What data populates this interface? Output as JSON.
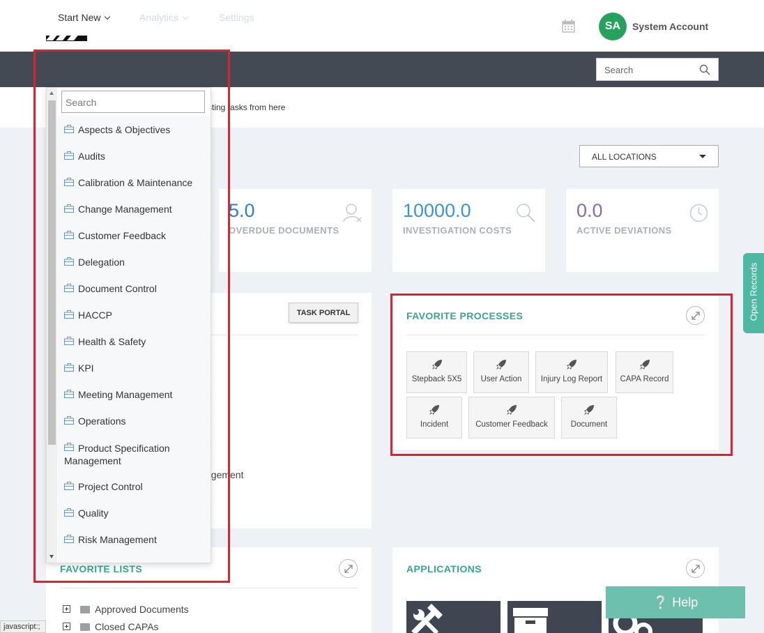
{
  "header": {
    "account_initials": "SA",
    "account_name": "System Account"
  },
  "nav": {
    "start_new": "Start New",
    "analytics": "Analytics",
    "settings": "Settings",
    "search_placeholder": "Search"
  },
  "subbar": {
    "text": "sting tasks from here"
  },
  "location_select": {
    "value": "ALL LOCATIONS"
  },
  "stats": [
    {
      "value": "5.0",
      "label": "OVERDUE DOCUMENTS",
      "icon": "user-x-icon",
      "color": "#2f7fc1"
    },
    {
      "value": "10000.0",
      "label": "INVESTIGATION COSTS",
      "icon": "search-icon",
      "color": "#3c95d1"
    },
    {
      "value": "0.0",
      "label": "ACTIVE DEVIATIONS",
      "icon": "clock-icon",
      "color": "#8a6bb0"
    }
  ],
  "task_panel": {
    "button": "TASK PORTAL",
    "partial_texts": [
      "e",
      "agement"
    ]
  },
  "favorite_processes": {
    "title": "FAVORITE PROCESSES",
    "items": [
      "Stepback 5X5",
      "User Action",
      "Injury Log Report",
      "CAPA Record",
      "Incident",
      "Customer Feedback",
      "Document"
    ]
  },
  "favorite_lists": {
    "title": "FAVORITE LISTS",
    "items": [
      "Approved Documents",
      "Closed CAPAs"
    ]
  },
  "applications": {
    "title": "APPLICATIONS"
  },
  "help": {
    "label": "Help"
  },
  "open_records": {
    "label": "Open Records"
  },
  "status_bar": {
    "text": "javascript:;"
  },
  "dropdown": {
    "search_placeholder": "Search",
    "items": [
      "Aspects & Objectives",
      "Audits",
      "Calibration & Maintenance",
      "Change Management",
      "Customer Feedback",
      "Delegation",
      "Document Control",
      "HACCP",
      "Health & Safety",
      "KPI",
      "Meeting Management",
      "Operations",
      "Product Specification Management",
      "Project Control",
      "Quality",
      "Risk Management"
    ]
  },
  "colors": {
    "accent": "#36a591",
    "nav_bg": "#434a54",
    "highlight": "#e0202d",
    "avatar": "#27a25e"
  }
}
